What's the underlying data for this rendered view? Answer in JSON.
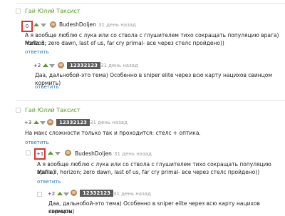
{
  "c1": {
    "author": "Гай Юлий Таксист",
    "score": "0",
    "user": "BudeshDoljen",
    "time": "31 день назад",
    "line1": "А я вообще люблю с лука или со ствола с глушителем тихо сокращать популяцию врага) Mafia 3,",
    "line2": "horizon; zero dawn, last of us, far cry primal- все через стелс пройдено))",
    "reply": "ответить"
  },
  "c2": {
    "score": "+2",
    "user": "12332123",
    "time": "31 день назад",
    "line1": "Даа, дальнобой-это тема) Особенно в sniper elite через всю карту нацихов свинцом кормить)",
    "reply": "ответить"
  },
  "c3": {
    "author": "Гай Юлий Таксист",
    "score": "+3",
    "user": "12332123",
    "time": "31 день назад",
    "line1": "На макс сложности только так и проходится: стелс + оптика.",
    "reply": "ответить"
  },
  "c4": {
    "score": "+1",
    "user": "BudeshDoljen",
    "time": "31 день назад",
    "line1": "А я вообще люблю с лука или со ствола с глушителем тихо сокращать популяцию врага)",
    "line2": "Mafia 3, horizon; zero dawn, last of us, far cry primal- все через стелс пройдено))",
    "reply": "ответить"
  },
  "c5": {
    "score": "+2",
    "user": "12332123",
    "time": "31 день назад",
    "line1": "Даа, дальнобой-это тема) Особенно в sniper elite через всю карту нацихов свинцом",
    "line2": "кормить)"
  }
}
